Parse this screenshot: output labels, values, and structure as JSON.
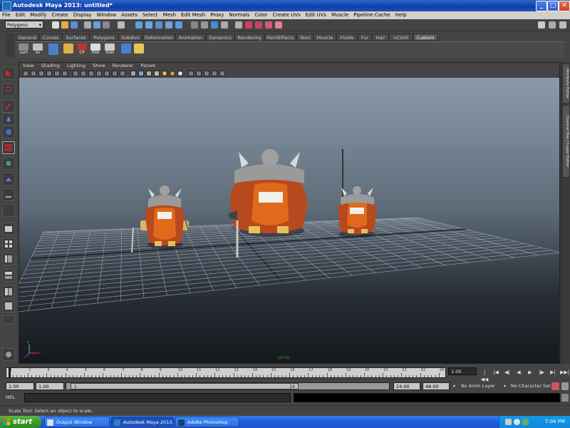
{
  "window": {
    "title": "Autodesk Maya 2013: untitled*",
    "minimize": "_",
    "maximize": "□",
    "close": "✕"
  },
  "menus": [
    "File",
    "Edit",
    "Modify",
    "Create",
    "Display",
    "Window",
    "Assets",
    "Select",
    "Mesh",
    "Edit Mesh",
    "Proxy",
    "Normals",
    "Color",
    "Create UVs",
    "Edit UVs",
    "Muscle",
    "Pipeline Cache",
    "Help"
  ],
  "status_line": {
    "menu_set": "Polygons",
    "menu_set_arrow": "▾"
  },
  "shelf_tabs": [
    "General",
    "Curves",
    "Surfaces",
    "Polygons",
    "Subdivs",
    "Deformation",
    "Animation",
    "Dynamics",
    "Rendering",
    "PaintEffects",
    "Toon",
    "Muscle",
    "Fluids",
    "Fur",
    "Hair",
    "nCloth",
    "Custom"
  ],
  "shelf_tabs_active": "Custom",
  "shelf_buttons": [
    {
      "label": "surf",
      "icon": "nurbs-surface-icon",
      "color": "#8a8a8a"
    },
    {
      "label": "zv",
      "icon": "zv-icon",
      "color": "#c0c0c0"
    },
    {
      "label": "",
      "icon": "cylinder-icon",
      "color": "#4b7fc8"
    },
    {
      "label": "",
      "icon": "cube-icon",
      "color": "#d9b04a"
    },
    {
      "label": "CP",
      "icon": "cp-icon",
      "color": "#b33"
    },
    {
      "label": "Hist",
      "icon": "history-icon",
      "color": "#ddd"
    },
    {
      "label": "Outl",
      "icon": "outliner-icon",
      "color": "#ccc"
    },
    {
      "label": "",
      "icon": "layers-icon",
      "color": "#4a7fd0"
    },
    {
      "label": "",
      "icon": "uv-icon",
      "color": "#e6c65a"
    }
  ],
  "viewport": {
    "menus": [
      "View",
      "Shading",
      "Lighting",
      "Show",
      "Renderer",
      "Panels"
    ],
    "camera_label": "persp",
    "axis_labels": {
      "x": "x",
      "y": "y",
      "z": "z"
    }
  },
  "side_tabs": [
    "Attribute Editor",
    "Channel Box / Layer Editor"
  ],
  "time_slider": {
    "ticks": [
      "1",
      "2",
      "3",
      "4",
      "5",
      "6",
      "7",
      "8",
      "9",
      "10",
      "11",
      "12",
      "13",
      "14",
      "15",
      "16",
      "17",
      "18",
      "19",
      "20",
      "21",
      "22",
      "23",
      "24"
    ],
    "current_frame": "1.00",
    "playback_buttons": [
      "|◀◀",
      "|◀",
      "◀|",
      "◀",
      "▶",
      "|▶",
      "▶|",
      "▶▶|"
    ]
  },
  "range_slider": {
    "start": "1.00",
    "playback_start": "1.00",
    "handle_start": "1",
    "handle_end": "24",
    "playback_end": "24.00",
    "end": "48.00",
    "anim_layer": "No Anim Layer",
    "character_set": "No Character Set"
  },
  "command_line": {
    "label": "MEL"
  },
  "help_line": {
    "text": "Scale Tool: Select an object to scale."
  },
  "taskbar": {
    "start_label": "start",
    "buttons": [
      {
        "label": "Output Window",
        "active": false
      },
      {
        "label": "Autodesk Maya 2013...",
        "active": true
      },
      {
        "label": "Adobe Photoshop",
        "active": false
      }
    ],
    "clock": "7:04 PM"
  },
  "colors": {
    "viewport_top": "#8b9aa9",
    "viewport_bottom": "#15181d",
    "xp_blue": "#245edb",
    "start_green": "#3a9a2a"
  }
}
